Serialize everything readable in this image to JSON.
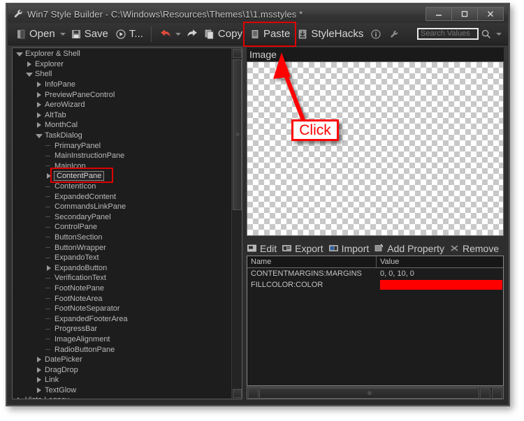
{
  "window": {
    "title": "Win7 Style Builder - C:\\Windows\\Resources\\Themes\\1\\1.msstyles *",
    "title_icon": "wrench-icon",
    "minimize_label": "–",
    "maximize_label": "□",
    "close_label": "✕"
  },
  "toolbar": {
    "open_label": "Open",
    "save_label": "Save",
    "t_label": "T...",
    "undo_label": "",
    "redo_label": "",
    "copy_label": "Copy",
    "paste_label": "Paste",
    "stylehacks_label": "StyleHacks",
    "info_label": "ⓘ",
    "wrench_label": "",
    "search_placeholder": "Search Values",
    "search_value": ""
  },
  "tree": {
    "items": [
      {
        "label": "Explorer & Shell",
        "indent": 0,
        "marker": "open"
      },
      {
        "label": "Explorer",
        "indent": 1,
        "marker": "closed"
      },
      {
        "label": "Shell",
        "indent": 1,
        "marker": "open"
      },
      {
        "label": "InfoPane",
        "indent": 2,
        "marker": "closed"
      },
      {
        "label": "PreviewPaneControl",
        "indent": 2,
        "marker": "closed"
      },
      {
        "label": "AeroWizard",
        "indent": 2,
        "marker": "closed"
      },
      {
        "label": "AltTab",
        "indent": 2,
        "marker": "closed"
      },
      {
        "label": "MonthCal",
        "indent": 2,
        "marker": "closed"
      },
      {
        "label": "TaskDialog",
        "indent": 2,
        "marker": "open"
      },
      {
        "label": "PrimaryPanel",
        "indent": 3,
        "marker": "leaf"
      },
      {
        "label": "MainInstructionPane",
        "indent": 3,
        "marker": "leaf"
      },
      {
        "label": "MainIcon",
        "indent": 3,
        "marker": "leaf"
      },
      {
        "label": "ContentPane",
        "indent": 3,
        "marker": "closed",
        "selected": true
      },
      {
        "label": "ContentIcon",
        "indent": 3,
        "marker": "leaf"
      },
      {
        "label": "ExpandedContent",
        "indent": 3,
        "marker": "leaf"
      },
      {
        "label": "CommandsLinkPane",
        "indent": 3,
        "marker": "leaf"
      },
      {
        "label": "SecondaryPanel",
        "indent": 3,
        "marker": "leaf"
      },
      {
        "label": "ControlPane",
        "indent": 3,
        "marker": "leaf"
      },
      {
        "label": "ButtonSection",
        "indent": 3,
        "marker": "leaf"
      },
      {
        "label": "ButtonWrapper",
        "indent": 3,
        "marker": "leaf"
      },
      {
        "label": "ExpandoText",
        "indent": 3,
        "marker": "leaf"
      },
      {
        "label": "ExpandoButton",
        "indent": 3,
        "marker": "closed"
      },
      {
        "label": "VerificationText",
        "indent": 3,
        "marker": "leaf"
      },
      {
        "label": "FootNotePane",
        "indent": 3,
        "marker": "leaf"
      },
      {
        "label": "FootNoteArea",
        "indent": 3,
        "marker": "leaf"
      },
      {
        "label": "FootNoteSeparator",
        "indent": 3,
        "marker": "leaf"
      },
      {
        "label": "ExpandedFooterArea",
        "indent": 3,
        "marker": "leaf"
      },
      {
        "label": "ProgressBar",
        "indent": 3,
        "marker": "leaf"
      },
      {
        "label": "ImageAlignment",
        "indent": 3,
        "marker": "leaf"
      },
      {
        "label": "RadioButtonPane",
        "indent": 3,
        "marker": "leaf"
      },
      {
        "label": "DatePicker",
        "indent": 2,
        "marker": "closed"
      },
      {
        "label": "DragDrop",
        "indent": 2,
        "marker": "closed"
      },
      {
        "label": "Link",
        "indent": 2,
        "marker": "closed"
      },
      {
        "label": "TextGlow",
        "indent": 2,
        "marker": "closed"
      },
      {
        "label": "Vista Legacy",
        "indent": 0,
        "marker": "closed"
      }
    ]
  },
  "image_panel": {
    "header_label": "Image"
  },
  "property_toolbar": {
    "edit_label": "Edit",
    "export_label": "Export",
    "import_label": "Import",
    "add_property_label": "Add Property",
    "remove_label": "Remove"
  },
  "property_table": {
    "columns": [
      "Name",
      "Value"
    ],
    "rows": [
      {
        "name": "CONTENTMARGINS:MARGINS",
        "value": "0, 0, 10, 0",
        "swatch": null
      },
      {
        "name": "FILLCOLOR:COLOR",
        "value": "",
        "swatch": "#ff0000"
      }
    ]
  },
  "annotation": {
    "click_label": "Click",
    "accent_color": "#ff0000"
  }
}
